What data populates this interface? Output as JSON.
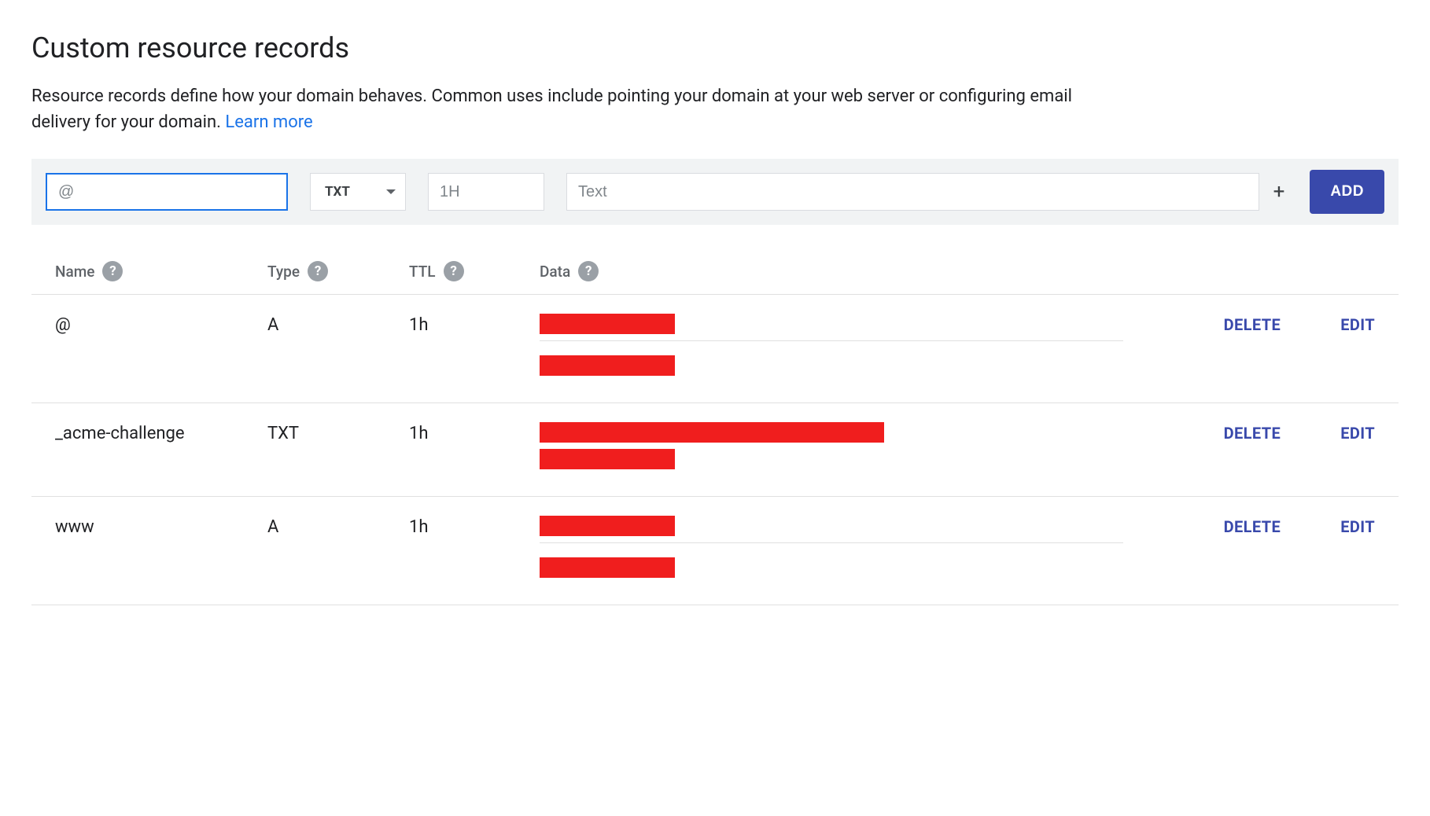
{
  "header": {
    "title": "Custom resource records",
    "description": "Resource records define how your domain behaves. Common uses include pointing your domain at your web server or configuring email delivery for your domain. ",
    "learn_more": "Learn more"
  },
  "add_form": {
    "name_placeholder": "@",
    "type_selected": "TXT",
    "ttl_placeholder": "1H",
    "data_placeholder": "Text",
    "add_button": "ADD"
  },
  "table": {
    "columns": {
      "name": "Name",
      "type": "Type",
      "ttl": "TTL",
      "data": "Data"
    },
    "actions": {
      "delete": "DELETE",
      "edit": "EDIT"
    },
    "rows": [
      {
        "name": "@",
        "type": "A",
        "ttl": "1h",
        "data": [
          {
            "redacted": true,
            "width": "small"
          },
          {
            "redacted": true,
            "width": "small"
          }
        ]
      },
      {
        "name": "_acme-challenge",
        "type": "TXT",
        "ttl": "1h",
        "data": [
          {
            "redacted": true,
            "width": "large"
          },
          {
            "redacted": true,
            "width": "small"
          }
        ]
      },
      {
        "name": "www",
        "type": "A",
        "ttl": "1h",
        "data": [
          {
            "redacted": true,
            "width": "small"
          },
          {
            "redacted": true,
            "width": "small"
          }
        ]
      }
    ]
  }
}
